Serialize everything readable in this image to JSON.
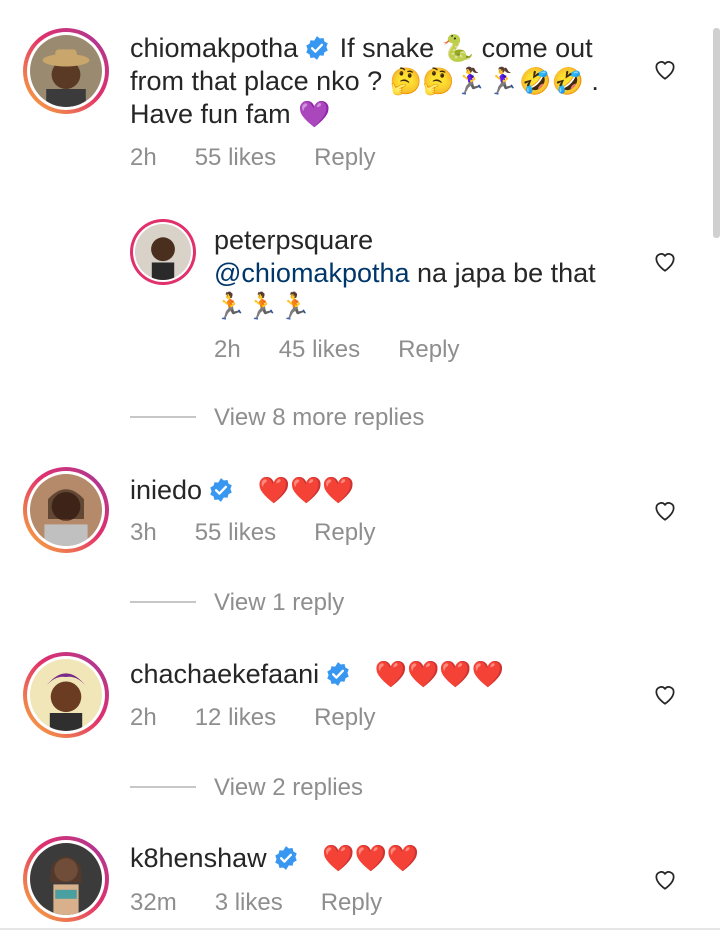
{
  "comments": [
    {
      "username": "chiomakpotha",
      "text_line1": "If snake",
      "text_snake": "🐍",
      "text_after_snake": "come out",
      "text_line2": "from that place nko ?",
      "text_line2_emoji": "🤔🤔🏃‍♀️🏃‍♀️🤣🤣",
      "text_line2_end": ".",
      "text_line3": "Have fun fam",
      "text_line3_emoji": "💜",
      "time": "2h",
      "likes": "55 likes",
      "reply": "Reply"
    },
    {
      "username": "peterpsquare",
      "mention": "@chiomakpotha",
      "text": "na japa be that",
      "emoji": "🏃🏃🏃",
      "time": "2h",
      "likes": "45 likes",
      "reply": "Reply"
    },
    {
      "username": "iniedo",
      "emoji": "❤️❤️❤️",
      "time": "3h",
      "likes": "55 likes",
      "reply": "Reply"
    },
    {
      "username": "chachaekefaani",
      "emoji": "❤️❤️❤️❤️",
      "time": "2h",
      "likes": "12 likes",
      "reply": "Reply"
    },
    {
      "username": "k8henshaw",
      "emoji": "❤️❤️❤️",
      "time": "32m",
      "likes": "3 likes",
      "reply": "Reply"
    }
  ],
  "view_replies": [
    "View 8 more replies",
    "View 1 reply",
    "View 2 replies"
  ],
  "icons": {
    "verified": "verified-badge-icon",
    "like": "heart-outline-icon"
  },
  "colors": {
    "verified_blue": "#3897f0",
    "mention": "#00376b",
    "meta_gray": "#8e8e8e"
  }
}
